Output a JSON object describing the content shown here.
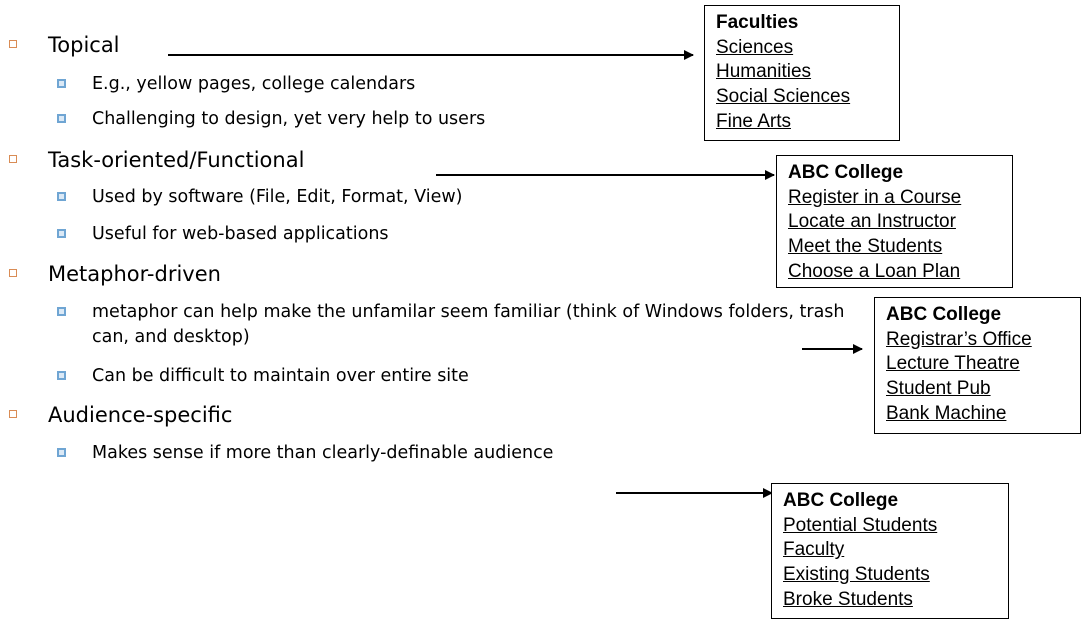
{
  "categories": [
    {
      "title": "Topical",
      "bullets": [
        "E.g., yellow pages, college calendars",
        "Challenging to design, yet very help to users"
      ],
      "example": {
        "heading": "Faculties",
        "items": [
          "Sciences",
          "Humanities",
          "Social Sciences",
          "Fine Arts"
        ]
      }
    },
    {
      "title": "Task-oriented/Functional",
      "bullets": [
        "Used by software (File, Edit, Format, View)",
        "Useful for web-based applications"
      ],
      "example": {
        "heading": "ABC College",
        "items": [
          "Register in a Course",
          "Locate an Instructor",
          "Meet the Students",
          "Choose a Loan Plan"
        ]
      }
    },
    {
      "title": "Metaphor-driven",
      "bullets": [
        "metaphor can help make the unfamilar seem familiar (think of Windows folders, trash can, and desktop)",
        "Can be difficult to maintain over entire site"
      ],
      "example": {
        "heading": "ABC College",
        "items": [
          "Registrar’s Office",
          "Lecture Theatre",
          "Student Pub",
          "Bank Machine"
        ]
      }
    },
    {
      "title": "Audience-specific",
      "bullets": [
        "Makes sense if more than clearly-definable audience"
      ],
      "example": {
        "heading": "ABC College",
        "items": [
          "Potential Students",
          "Faculty",
          "Existing Students",
          "Broke Students"
        ]
      }
    }
  ],
  "colors": {
    "level1_bullet": "#d98c55",
    "level2_bullet": "#6fa5d3"
  }
}
